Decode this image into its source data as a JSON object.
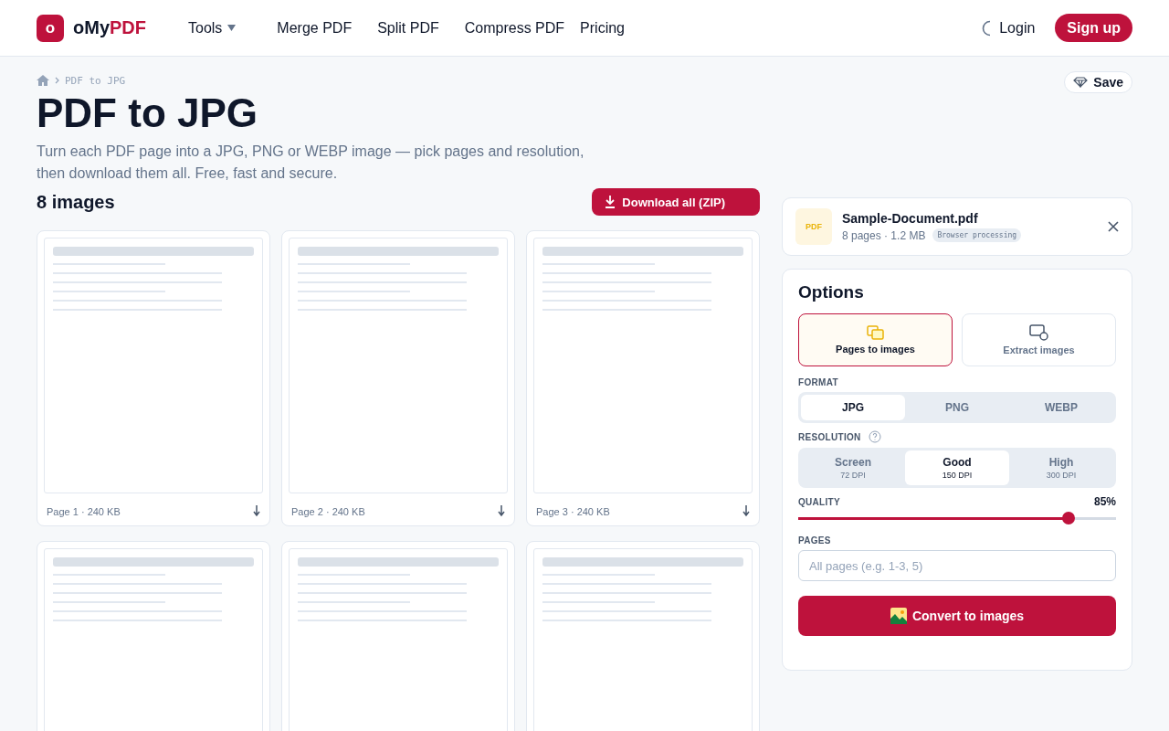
{
  "header": {
    "logo_mark": "o",
    "logo_text_1": "oMy",
    "logo_text_2": "PDF",
    "nav": [
      {
        "label": "Tools",
        "dropdown": true
      },
      {
        "label": "Merge PDF",
        "dropdown": false
      },
      {
        "label": "Split PDF",
        "dropdown": false
      },
      {
        "label": "Compress PDF",
        "dropdown": false
      },
      {
        "label": "Pricing",
        "dropdown": false
      }
    ],
    "login": "Login",
    "signup": "Sign up"
  },
  "breadcrumb": "PDF to JPG",
  "save": "Save",
  "title": "PDF to JPG",
  "subtitle": "Turn each PDF page into a JPG, PNG or WEBP image — pick pages and resolution, then download them all. Free, fast and secure.",
  "results": {
    "count": "8 images",
    "download_all": "Download all (ZIP)",
    "pages": [
      {
        "kind": "page",
        "caption": "Page 1 · 240 KB"
      },
      {
        "kind": "page",
        "caption": "Page 2 · 240 KB"
      },
      {
        "kind": "page",
        "caption": "Page 3 · 240 KB"
      },
      {
        "kind": "page"
      },
      {
        "kind": "page"
      },
      {
        "kind": "page"
      }
    ]
  },
  "file": {
    "badge": "PDF",
    "name": "Sample-Document.pdf",
    "meta": "8 pages · 1.2 MB",
    "tag": "Browser processing"
  },
  "options": {
    "title": "Options",
    "modes": [
      {
        "label": "Pages to images",
        "selected": true
      },
      {
        "label": "Extract images",
        "selected": false
      }
    ],
    "format_label": "FORMAT",
    "formats": [
      {
        "label": "JPG",
        "selected": true
      },
      {
        "label": "PNG",
        "selected": false
      },
      {
        "label": "WEBP",
        "selected": false
      }
    ],
    "resolution_label": "RESOLUTION",
    "resolutions": [
      {
        "label": "Screen",
        "dpi": "72 DPI",
        "selected": false
      },
      {
        "label": "Good",
        "dpi": "150 DPI",
        "selected": true
      },
      {
        "label": "High",
        "dpi": "300 DPI",
        "selected": false
      }
    ],
    "quality_label": "QUALITY",
    "quality_reading": "85%",
    "quality": {
      "level": 0.85
    },
    "pages_label": "PAGES",
    "pages_placeholder": "All pages (e.g. 1-3, 5)",
    "convert": "Convert to images"
  }
}
